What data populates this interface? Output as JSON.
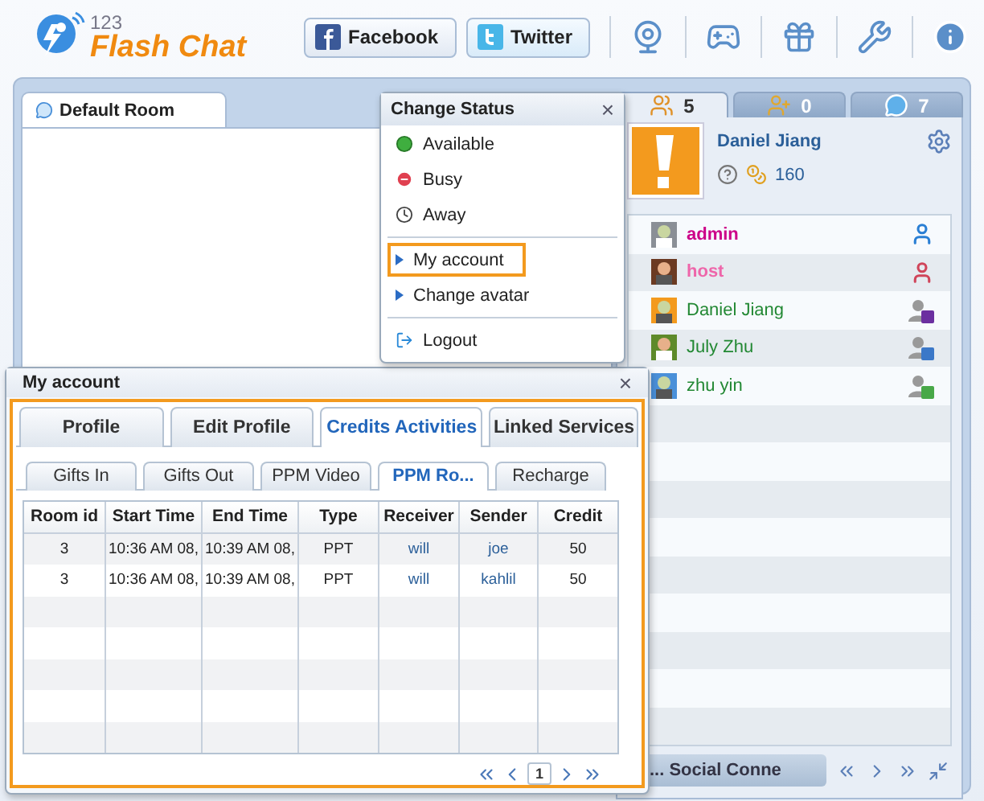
{
  "logo": {
    "number": "123",
    "name": "Flash Chat"
  },
  "header_buttons": [
    {
      "label": "Facebook",
      "kind": "facebook"
    },
    {
      "label": "Twitter",
      "kind": "twitter"
    }
  ],
  "room_tab": {
    "title": "Default Room"
  },
  "user_tabs": [
    {
      "count": "5",
      "kind": "users",
      "selected": true
    },
    {
      "count": "0",
      "kind": "friends",
      "selected": false
    },
    {
      "count": "7",
      "kind": "chats",
      "selected": false
    }
  ],
  "profile": {
    "name": "Daniel Jiang",
    "credits": "160"
  },
  "users": [
    {
      "name": "admin",
      "color": "#cc0088",
      "kind": "admin"
    },
    {
      "name": "host",
      "color": "#ee66aa",
      "kind": "host"
    },
    {
      "name": "Daniel Jiang",
      "color": "#228833",
      "kind": "yahoo"
    },
    {
      "name": "July Zhu",
      "color": "#228833",
      "kind": "google"
    },
    {
      "name": "zhu yin",
      "color": "#228833",
      "kind": "msn"
    }
  ],
  "bottom_bar": {
    "label": "... Social Conne"
  },
  "status_menu": {
    "title": "Change Status",
    "close": "×",
    "items": [
      {
        "label": "Available",
        "kind": "available",
        "selected": false
      },
      {
        "label": "Busy",
        "kind": "busy",
        "selected": false
      },
      {
        "label": "Away",
        "kind": "away",
        "selected": false
      },
      {
        "label": "My account",
        "kind": "link",
        "selected": true
      },
      {
        "label": "Change avatar",
        "kind": "link",
        "selected": false
      },
      {
        "label": "Logout",
        "kind": "logout",
        "selected": false
      }
    ]
  },
  "account_dialog": {
    "title": "My account",
    "close": "×",
    "tabs": [
      {
        "label": "Profile",
        "selected": false
      },
      {
        "label": "Edit Profile",
        "selected": false
      },
      {
        "label": "Credits Activities",
        "selected": true
      },
      {
        "label": "Linked Services",
        "selected": false
      }
    ],
    "subtabs": [
      {
        "label": "Gifts In",
        "selected": false
      },
      {
        "label": "Gifts Out",
        "selected": false
      },
      {
        "label": "PPM Video",
        "selected": false
      },
      {
        "label": "PPM Ro...",
        "selected": true
      },
      {
        "label": "Recharge",
        "selected": false
      }
    ],
    "table": {
      "columns": [
        "Room id",
        "Start Time",
        "End Time",
        "Type",
        "Receiver",
        "Sender",
        "Credit"
      ],
      "rows": [
        [
          "3",
          "10:36 AM 08,",
          "10:39 AM 08,",
          "PPT",
          "will",
          "joe",
          "50"
        ],
        [
          "3",
          "10:36 AM 08,",
          "10:39 AM 08,",
          "PPT",
          "will",
          "kahlil",
          "50"
        ]
      ]
    },
    "pagination": {
      "page": "1"
    }
  }
}
